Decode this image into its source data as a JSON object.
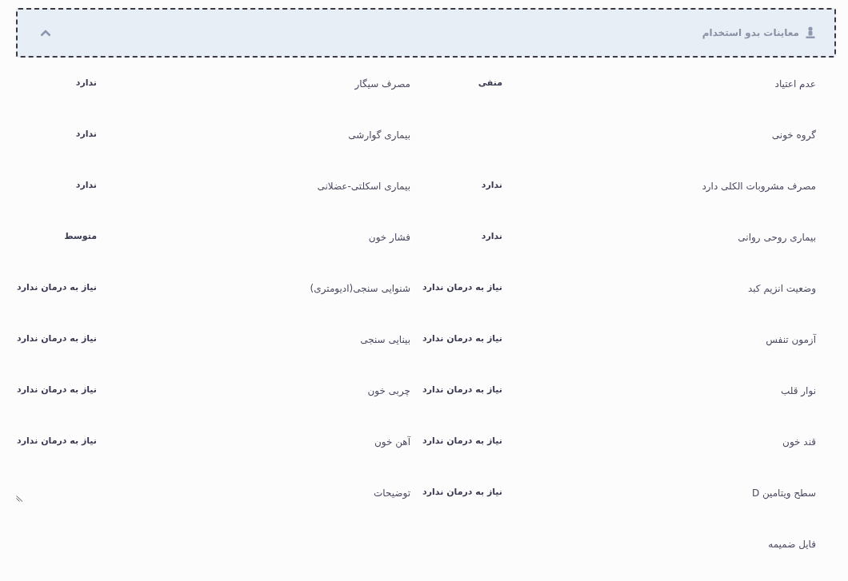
{
  "section": {
    "title": "معاینات بدو استخدام",
    "expanded": true
  },
  "rows": [
    {
      "fields": [
        {
          "kind": "text",
          "label": "عدم اعتیاد",
          "value": "منفی"
        },
        {
          "kind": "text",
          "label": "مصرف سیگار",
          "value": "ندارد"
        }
      ]
    },
    {
      "fields": [
        {
          "kind": "text",
          "label": "گروه خونی"
        },
        {
          "kind": "text",
          "label": "بیماری گوارشی",
          "value": "ندارد"
        }
      ]
    },
    {
      "fields": [
        {
          "kind": "text",
          "label": "مصرف مشروبات الکلی دارد",
          "value": "ندارد"
        },
        {
          "kind": "text",
          "label": "بیماری اسکلتی-عضلانی",
          "value": "ندارد"
        }
      ]
    },
    {
      "fields": [
        {
          "kind": "text",
          "label": "بیماری روحی روانی",
          "value": "ندارد"
        },
        {
          "kind": "text",
          "label": "فشار خون",
          "value": "متوسط"
        }
      ]
    },
    {
      "fields": [
        {
          "kind": "text",
          "label": "وضعیت انزیم کبد",
          "value": "نیاز به درمان ندارد"
        },
        {
          "kind": "text",
          "label": "شنوایی سنجی(ادیومتری)",
          "value": "نیاز به درمان ندارد"
        }
      ]
    },
    {
      "fields": [
        {
          "kind": "text",
          "label": "آزمون تنفس",
          "value": "نیاز به درمان ندارد"
        },
        {
          "kind": "text",
          "label": "بینایی سنجی",
          "value": "نیاز به درمان ندارد"
        }
      ]
    },
    {
      "fields": [
        {
          "kind": "text",
          "label": "نوار قلب",
          "value": "نیاز به درمان ندارد"
        },
        {
          "kind": "text",
          "label": "چربی خون",
          "value": "نیاز به درمان ندارد"
        }
      ]
    },
    {
      "fields": [
        {
          "kind": "text",
          "label": "قند خون",
          "value": "نیاز به درمان ندارد"
        },
        {
          "kind": "text",
          "label": "آهن خون",
          "value": "نیاز به درمان ندارد"
        }
      ]
    },
    {
      "fields": [
        {
          "kind": "text",
          "label": "سطح ویتامین D",
          "value": "نیاز به درمان ندارد"
        },
        {
          "kind": "textarea",
          "label": "توضیحات"
        }
      ]
    },
    {
      "fields": [
        {
          "kind": "file",
          "label": "فایل ضمیمه"
        }
      ]
    }
  ]
}
